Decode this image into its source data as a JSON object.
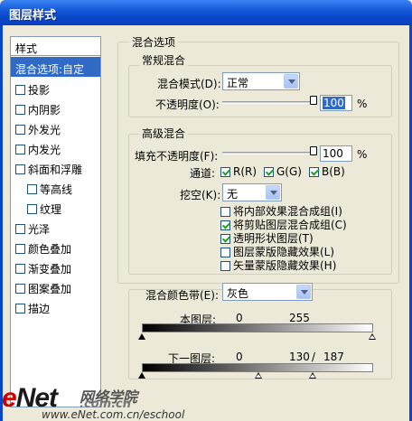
{
  "window": {
    "title": "图层样式"
  },
  "style_list": {
    "header": "样式",
    "items": [
      {
        "label": "混合选项:自定",
        "selected": true,
        "checkbox": false,
        "indent": false
      },
      {
        "label": "投影",
        "checkbox": true,
        "checked": false,
        "indent": false
      },
      {
        "label": "内阴影",
        "checkbox": true,
        "checked": false,
        "indent": false
      },
      {
        "label": "外发光",
        "checkbox": true,
        "checked": false,
        "indent": false
      },
      {
        "label": "内发光",
        "checkbox": true,
        "checked": false,
        "indent": false
      },
      {
        "label": "斜面和浮雕",
        "checkbox": true,
        "checked": false,
        "indent": false
      },
      {
        "label": "等高线",
        "checkbox": true,
        "checked": false,
        "indent": true
      },
      {
        "label": "纹理",
        "checkbox": true,
        "checked": false,
        "indent": true
      },
      {
        "label": "光泽",
        "checkbox": true,
        "checked": false,
        "indent": false
      },
      {
        "label": "颜色叠加",
        "checkbox": true,
        "checked": false,
        "indent": false
      },
      {
        "label": "渐变叠加",
        "checkbox": true,
        "checked": false,
        "indent": false
      },
      {
        "label": "图案叠加",
        "checkbox": true,
        "checked": false,
        "indent": false
      },
      {
        "label": "描边",
        "checkbox": true,
        "checked": false,
        "indent": false
      }
    ]
  },
  "blend_options": {
    "title": "混合选项",
    "general": {
      "title": "常规混合",
      "blend_mode_label": "混合模式(D):",
      "blend_mode_value": "正常",
      "opacity_label": "不透明度(O):",
      "opacity_value": "100",
      "opacity_unit": "%"
    },
    "advanced": {
      "title": "高级混合",
      "fill_opacity_label": "填充不透明度(F):",
      "fill_opacity_value": "100",
      "fill_opacity_unit": "%",
      "channels_label": "通道:",
      "channel_r": "R(R)",
      "channel_g": "G(G)",
      "channel_b": "B(B)",
      "knockout_label": "挖空(K):",
      "knockout_value": "无",
      "options": [
        {
          "label": "将内部效果混合成组(I)",
          "checked": false
        },
        {
          "label": "将剪贴图层混合成组(C)",
          "checked": true
        },
        {
          "label": "透明形状图层(T)",
          "checked": true
        },
        {
          "label": "图层蒙版隐藏效果(L)",
          "checked": false
        },
        {
          "label": "矢量蒙版隐藏效果(H)",
          "checked": false
        }
      ]
    },
    "blend_if": {
      "label": "混合颜色带(E):",
      "value": "灰色",
      "this_layer_label": "本图层:",
      "this_layer_low": "0",
      "this_layer_high": "255",
      "underlying_label": "下一图层:",
      "underlying_low": "0",
      "underlying_high_a": "130",
      "underlying_sep": "/",
      "underlying_high_b": "187"
    }
  },
  "watermark": {
    "brand": "eNet",
    "domain": ".com.cn",
    "cn": "网络学院",
    "url": "www.eNet.com.cn/eschool"
  }
}
